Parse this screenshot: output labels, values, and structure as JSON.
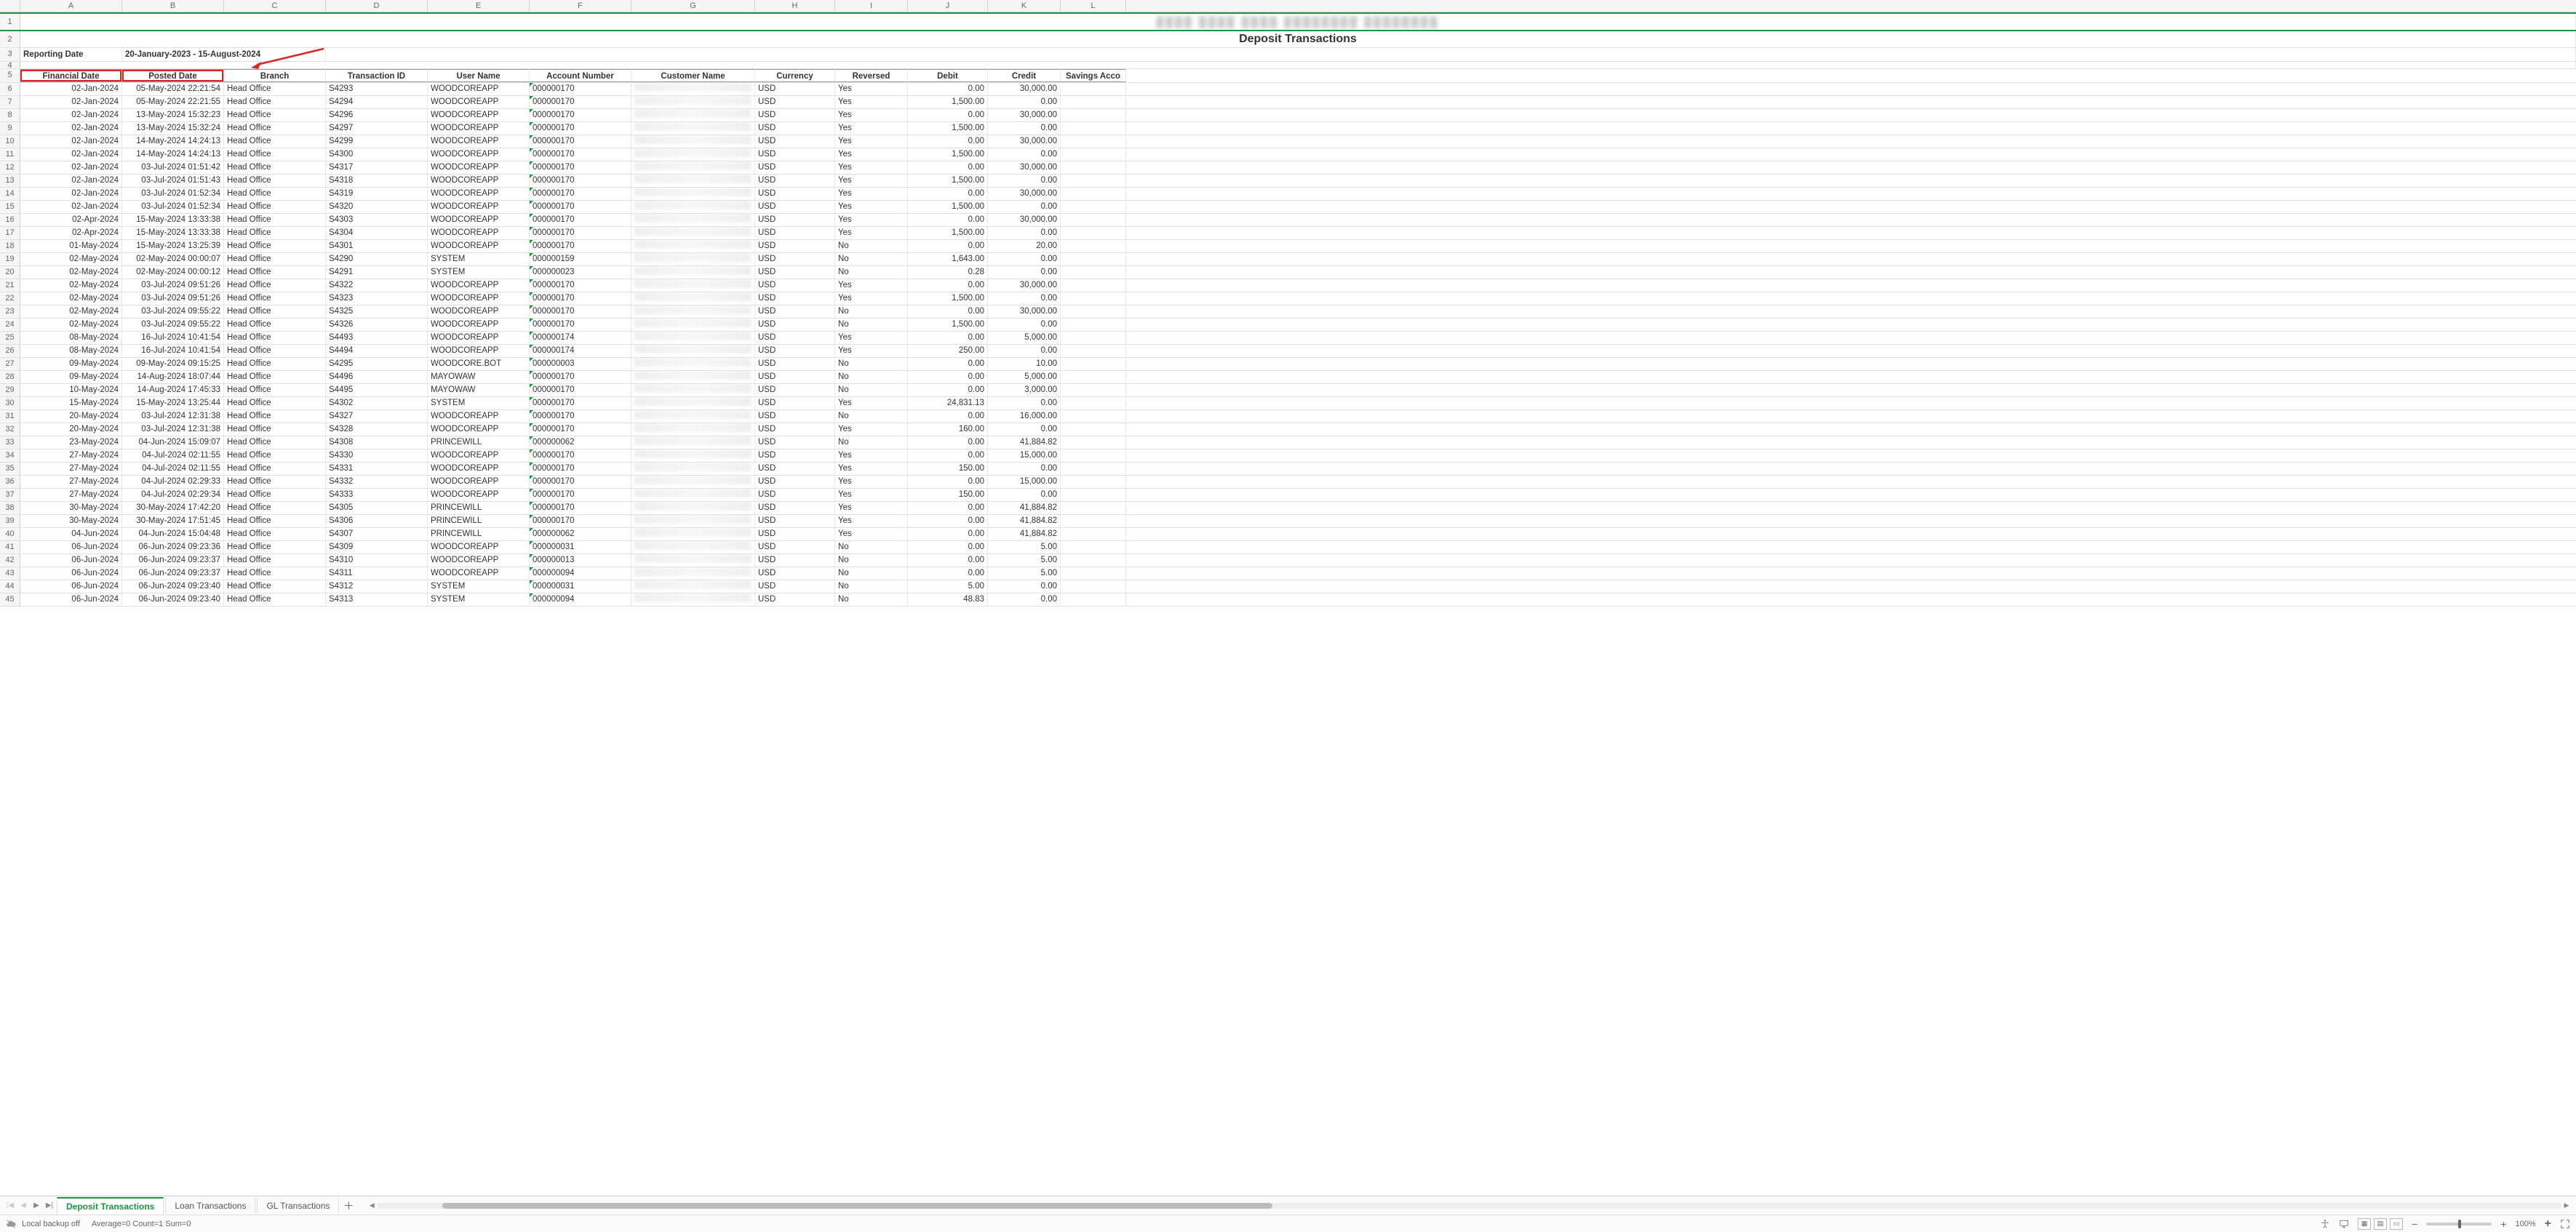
{
  "columns": [
    "A",
    "B",
    "C",
    "D",
    "E",
    "F",
    "G",
    "H",
    "I",
    "J",
    "K",
    "L"
  ],
  "title_row1_masked": "████  ████  ████  ████████   ████████",
  "title_row2": "Deposit Transactions",
  "reporting_label": "Reporting Date",
  "reporting_value": "20-January-2023 - 15-August-2024",
  "headers": {
    "a": "Financial Date",
    "b": "Posted Date",
    "c": "Branch",
    "d": "Transaction ID",
    "e": "User Name",
    "f": "Account Number",
    "g": "Customer Name",
    "h": "Currency",
    "i": "Reversed",
    "j": "Debit",
    "k": "Credit",
    "l": "Savings Acco"
  },
  "rows": [
    {
      "n": 6,
      "fd": "02-Jan-2024",
      "pd": "05-May-2024 22:21:54",
      "br": "Head Office",
      "tid": "S4293",
      "un": "WOODCOREAPP",
      "acct": "000000170",
      "cust": "",
      "cur": "USD",
      "rev": "Yes",
      "deb": "0.00",
      "cr": "30,000.00"
    },
    {
      "n": 7,
      "fd": "02-Jan-2024",
      "pd": "05-May-2024 22:21:55",
      "br": "Head Office",
      "tid": "S4294",
      "un": "WOODCOREAPP",
      "acct": "000000170",
      "cust": "",
      "cur": "USD",
      "rev": "Yes",
      "deb": "1,500.00",
      "cr": "0.00"
    },
    {
      "n": 8,
      "fd": "02-Jan-2024",
      "pd": "13-May-2024 15:32:23",
      "br": "Head Office",
      "tid": "S4296",
      "un": "WOODCOREAPP",
      "acct": "000000170",
      "cust": "",
      "cur": "USD",
      "rev": "Yes",
      "deb": "0.00",
      "cr": "30,000.00"
    },
    {
      "n": 9,
      "fd": "02-Jan-2024",
      "pd": "13-May-2024 15:32:24",
      "br": "Head Office",
      "tid": "S4297",
      "un": "WOODCOREAPP",
      "acct": "000000170",
      "cust": "",
      "cur": "USD",
      "rev": "Yes",
      "deb": "1,500.00",
      "cr": "0.00"
    },
    {
      "n": 10,
      "fd": "02-Jan-2024",
      "pd": "14-May-2024 14:24:13",
      "br": "Head Office",
      "tid": "S4299",
      "un": "WOODCOREAPP",
      "acct": "000000170",
      "cust": "",
      "cur": "USD",
      "rev": "Yes",
      "deb": "0.00",
      "cr": "30,000.00"
    },
    {
      "n": 11,
      "fd": "02-Jan-2024",
      "pd": "14-May-2024 14:24:13",
      "br": "Head Office",
      "tid": "S4300",
      "un": "WOODCOREAPP",
      "acct": "000000170",
      "cust": "",
      "cur": "USD",
      "rev": "Yes",
      "deb": "1,500.00",
      "cr": "0.00"
    },
    {
      "n": 12,
      "fd": "02-Jan-2024",
      "pd": "03-Jul-2024 01:51:42",
      "br": "Head Office",
      "tid": "S4317",
      "un": "WOODCOREAPP",
      "acct": "000000170",
      "cust": "",
      "cur": "USD",
      "rev": "Yes",
      "deb": "0.00",
      "cr": "30,000.00"
    },
    {
      "n": 13,
      "fd": "02-Jan-2024",
      "pd": "03-Jul-2024 01:51:43",
      "br": "Head Office",
      "tid": "S4318",
      "un": "WOODCOREAPP",
      "acct": "000000170",
      "cust": "",
      "cur": "USD",
      "rev": "Yes",
      "deb": "1,500.00",
      "cr": "0.00"
    },
    {
      "n": 14,
      "fd": "02-Jan-2024",
      "pd": "03-Jul-2024 01:52:34",
      "br": "Head Office",
      "tid": "S4319",
      "un": "WOODCOREAPP",
      "acct": "000000170",
      "cust": "",
      "cur": "USD",
      "rev": "Yes",
      "deb": "0.00",
      "cr": "30,000.00"
    },
    {
      "n": 15,
      "fd": "02-Jan-2024",
      "pd": "03-Jul-2024 01:52:34",
      "br": "Head Office",
      "tid": "S4320",
      "un": "WOODCOREAPP",
      "acct": "000000170",
      "cust": "",
      "cur": "USD",
      "rev": "Yes",
      "deb": "1,500.00",
      "cr": "0.00"
    },
    {
      "n": 16,
      "fd": "02-Apr-2024",
      "pd": "15-May-2024 13:33:38",
      "br": "Head Office",
      "tid": "S4303",
      "un": "WOODCOREAPP",
      "acct": "000000170",
      "cust": "",
      "cur": "USD",
      "rev": "Yes",
      "deb": "0.00",
      "cr": "30,000.00"
    },
    {
      "n": 17,
      "fd": "02-Apr-2024",
      "pd": "15-May-2024 13:33:38",
      "br": "Head Office",
      "tid": "S4304",
      "un": "WOODCOREAPP",
      "acct": "000000170",
      "cust": "",
      "cur": "USD",
      "rev": "Yes",
      "deb": "1,500.00",
      "cr": "0.00"
    },
    {
      "n": 18,
      "fd": "01-May-2024",
      "pd": "15-May-2024 13:25:39",
      "br": "Head Office",
      "tid": "S4301",
      "un": "WOODCOREAPP",
      "acct": "000000170",
      "cust": "",
      "cur": "USD",
      "rev": "No",
      "deb": "0.00",
      "cr": "20.00"
    },
    {
      "n": 19,
      "fd": "02-May-2024",
      "pd": "02-May-2024 00:00:07",
      "br": "Head Office",
      "tid": "S4290",
      "un": "SYSTEM",
      "acct": "000000159",
      "cust": "",
      "cur": "USD",
      "rev": "No",
      "deb": "1,643.00",
      "cr": "0.00"
    },
    {
      "n": 20,
      "fd": "02-May-2024",
      "pd": "02-May-2024 00:00:12",
      "br": "Head Office",
      "tid": "S4291",
      "un": "SYSTEM",
      "acct": "000000023",
      "cust": "",
      "cur": "USD",
      "rev": "No",
      "deb": "0.28",
      "cr": "0.00"
    },
    {
      "n": 21,
      "fd": "02-May-2024",
      "pd": "03-Jul-2024 09:51:26",
      "br": "Head Office",
      "tid": "S4322",
      "un": "WOODCOREAPP",
      "acct": "000000170",
      "cust": "",
      "cur": "USD",
      "rev": "Yes",
      "deb": "0.00",
      "cr": "30,000.00"
    },
    {
      "n": 22,
      "fd": "02-May-2024",
      "pd": "03-Jul-2024 09:51:26",
      "br": "Head Office",
      "tid": "S4323",
      "un": "WOODCOREAPP",
      "acct": "000000170",
      "cust": "",
      "cur": "USD",
      "rev": "Yes",
      "deb": "1,500.00",
      "cr": "0.00"
    },
    {
      "n": 23,
      "fd": "02-May-2024",
      "pd": "03-Jul-2024 09:55:22",
      "br": "Head Office",
      "tid": "S4325",
      "un": "WOODCOREAPP",
      "acct": "000000170",
      "cust": "",
      "cur": "USD",
      "rev": "No",
      "deb": "0.00",
      "cr": "30,000.00"
    },
    {
      "n": 24,
      "fd": "02-May-2024",
      "pd": "03-Jul-2024 09:55:22",
      "br": "Head Office",
      "tid": "S4326",
      "un": "WOODCOREAPP",
      "acct": "000000170",
      "cust": "",
      "cur": "USD",
      "rev": "No",
      "deb": "1,500.00",
      "cr": "0.00"
    },
    {
      "n": 25,
      "fd": "08-May-2024",
      "pd": "16-Jul-2024 10:41:54",
      "br": "Head Office",
      "tid": "S4493",
      "un": "WOODCOREAPP",
      "acct": "000000174",
      "cust": "",
      "cur": "USD",
      "rev": "Yes",
      "deb": "0.00",
      "cr": "5,000.00"
    },
    {
      "n": 26,
      "fd": "08-May-2024",
      "pd": "16-Jul-2024 10:41:54",
      "br": "Head Office",
      "tid": "S4494",
      "un": "WOODCOREAPP",
      "acct": "000000174",
      "cust": "",
      "cur": "USD",
      "rev": "Yes",
      "deb": "250.00",
      "cr": "0.00"
    },
    {
      "n": 27,
      "fd": "09-May-2024",
      "pd": "09-May-2024 09:15:25",
      "br": "Head Office",
      "tid": "S4295",
      "un": "WOODCORE.BOT",
      "acct": "000000003",
      "cust": "",
      "cur": "USD",
      "rev": "No",
      "deb": "0.00",
      "cr": "10.00"
    },
    {
      "n": 28,
      "fd": "09-May-2024",
      "pd": "14-Aug-2024 18:07:44",
      "br": "Head Office",
      "tid": "S4496",
      "un": "MAYOWAW",
      "acct": "000000170",
      "cust": "",
      "cur": "USD",
      "rev": "No",
      "deb": "0.00",
      "cr": "5,000.00"
    },
    {
      "n": 29,
      "fd": "10-May-2024",
      "pd": "14-Aug-2024 17:45:33",
      "br": "Head Office",
      "tid": "S4495",
      "un": "MAYOWAW",
      "acct": "000000170",
      "cust": "",
      "cur": "USD",
      "rev": "No",
      "deb": "0.00",
      "cr": "3,000.00"
    },
    {
      "n": 30,
      "fd": "15-May-2024",
      "pd": "15-May-2024 13:25:44",
      "br": "Head Office",
      "tid": "S4302",
      "un": "SYSTEM",
      "acct": "000000170",
      "cust": "",
      "cur": "USD",
      "rev": "Yes",
      "deb": "24,831.13",
      "cr": "0.00"
    },
    {
      "n": 31,
      "fd": "20-May-2024",
      "pd": "03-Jul-2024 12:31:38",
      "br": "Head Office",
      "tid": "S4327",
      "un": "WOODCOREAPP",
      "acct": "000000170",
      "cust": "",
      "cur": "USD",
      "rev": "No",
      "deb": "0.00",
      "cr": "16,000.00"
    },
    {
      "n": 32,
      "fd": "20-May-2024",
      "pd": "03-Jul-2024 12:31:38",
      "br": "Head Office",
      "tid": "S4328",
      "un": "WOODCOREAPP",
      "acct": "000000170",
      "cust": "",
      "cur": "USD",
      "rev": "Yes",
      "deb": "160.00",
      "cr": "0.00"
    },
    {
      "n": 33,
      "fd": "23-May-2024",
      "pd": "04-Jun-2024 15:09:07",
      "br": "Head Office",
      "tid": "S4308",
      "un": "PRINCEWILL",
      "acct": "000000062",
      "cust": "",
      "cur": "USD",
      "rev": "No",
      "deb": "0.00",
      "cr": "41,884.82"
    },
    {
      "n": 34,
      "fd": "27-May-2024",
      "pd": "04-Jul-2024 02:11:55",
      "br": "Head Office",
      "tid": "S4330",
      "un": "WOODCOREAPP",
      "acct": "000000170",
      "cust": "",
      "cur": "USD",
      "rev": "Yes",
      "deb": "0.00",
      "cr": "15,000.00"
    },
    {
      "n": 35,
      "fd": "27-May-2024",
      "pd": "04-Jul-2024 02:11:55",
      "br": "Head Office",
      "tid": "S4331",
      "un": "WOODCOREAPP",
      "acct": "000000170",
      "cust": "",
      "cur": "USD",
      "rev": "Yes",
      "deb": "150.00",
      "cr": "0.00"
    },
    {
      "n": 36,
      "fd": "27-May-2024",
      "pd": "04-Jul-2024 02:29:33",
      "br": "Head Office",
      "tid": "S4332",
      "un": "WOODCOREAPP",
      "acct": "000000170",
      "cust": "",
      "cur": "USD",
      "rev": "Yes",
      "deb": "0.00",
      "cr": "15,000.00"
    },
    {
      "n": 37,
      "fd": "27-May-2024",
      "pd": "04-Jul-2024 02:29:34",
      "br": "Head Office",
      "tid": "S4333",
      "un": "WOODCOREAPP",
      "acct": "000000170",
      "cust": "",
      "cur": "USD",
      "rev": "Yes",
      "deb": "150.00",
      "cr": "0.00"
    },
    {
      "n": 38,
      "fd": "30-May-2024",
      "pd": "30-May-2024 17:42:20",
      "br": "Head Office",
      "tid": "S4305",
      "un": "PRINCEWILL",
      "acct": "000000170",
      "cust": "",
      "cur": "USD",
      "rev": "Yes",
      "deb": "0.00",
      "cr": "41,884.82"
    },
    {
      "n": 39,
      "fd": "30-May-2024",
      "pd": "30-May-2024 17:51:45",
      "br": "Head Office",
      "tid": "S4306",
      "un": "PRINCEWILL",
      "acct": "000000170",
      "cust": "",
      "cur": "USD",
      "rev": "Yes",
      "deb": "0.00",
      "cr": "41,884.82"
    },
    {
      "n": 40,
      "fd": "04-Jun-2024",
      "pd": "04-Jun-2024 15:04:48",
      "br": "Head Office",
      "tid": "S4307",
      "un": "PRINCEWILL",
      "acct": "000000062",
      "cust": "",
      "cur": "USD",
      "rev": "Yes",
      "deb": "0.00",
      "cr": "41,884.82"
    },
    {
      "n": 41,
      "fd": "06-Jun-2024",
      "pd": "06-Jun-2024 09:23:36",
      "br": "Head Office",
      "tid": "S4309",
      "un": "WOODCOREAPP",
      "acct": "000000031",
      "cust": "",
      "cur": "USD",
      "rev": "No",
      "deb": "0.00",
      "cr": "5.00"
    },
    {
      "n": 42,
      "fd": "06-Jun-2024",
      "pd": "06-Jun-2024 09:23:37",
      "br": "Head Office",
      "tid": "S4310",
      "un": "WOODCOREAPP",
      "acct": "000000013",
      "cust": "",
      "cur": "USD",
      "rev": "No",
      "deb": "0.00",
      "cr": "5.00"
    },
    {
      "n": 43,
      "fd": "06-Jun-2024",
      "pd": "06-Jun-2024 09:23:37",
      "br": "Head Office",
      "tid": "S4311",
      "un": "WOODCOREAPP",
      "acct": "000000094",
      "cust": "",
      "cur": "USD",
      "rev": "No",
      "deb": "0.00",
      "cr": "5.00"
    },
    {
      "n": 44,
      "fd": "06-Jun-2024",
      "pd": "06-Jun-2024 09:23:40",
      "br": "Head Office",
      "tid": "S4312",
      "un": "SYSTEM",
      "acct": "000000031",
      "cust": "",
      "cur": "USD",
      "rev": "No",
      "deb": "5.00",
      "cr": "0.00"
    },
    {
      "n": 45,
      "fd": "06-Jun-2024",
      "pd": "06-Jun-2024 09:23:40",
      "br": "Head Office",
      "tid": "S4313",
      "un": "SYSTEM",
      "acct": "000000094",
      "cust": "",
      "cur": "USD",
      "rev": "No",
      "deb": "48.83",
      "cr": "0.00"
    }
  ],
  "tabs": {
    "active": "Deposit Transactions",
    "t2": "Loan Transactions",
    "t3": "GL Transactions"
  },
  "status": {
    "backup": "Local backup off",
    "stats": "Average=0  Count=1  Sum=0",
    "zoom": "100%"
  }
}
